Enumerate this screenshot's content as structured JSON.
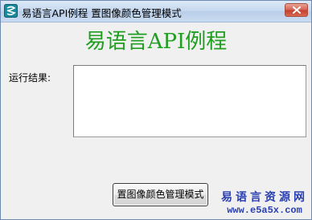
{
  "window": {
    "title": "易语言API例程 置图像颜色管理模式",
    "icon": "e-language-logo-icon",
    "close_icon": "close-icon"
  },
  "main": {
    "heading": "易语言API例程",
    "result_label": "运行结果:",
    "result_value": "",
    "action_button_label": "置图像颜色管理模式"
  },
  "watermark": {
    "line1": "易语言资源网",
    "line2": "www.e5a5x.com"
  },
  "colors": {
    "heading": "#1f9e1f",
    "watermark": "#2a3fb0",
    "close_button": "#c4402f"
  }
}
